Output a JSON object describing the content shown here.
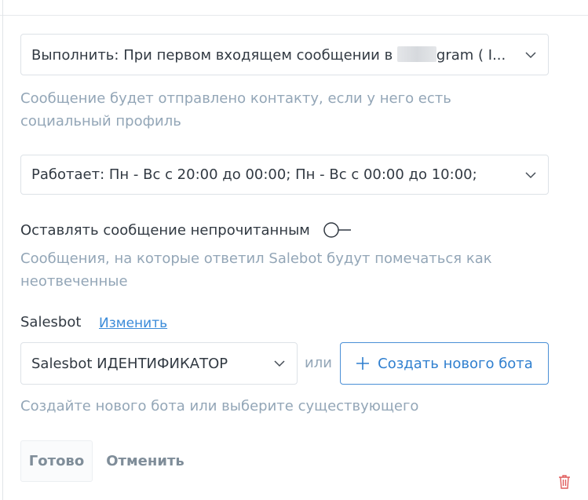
{
  "trigger_select": {
    "value_prefix": "Выполнить: При первом входящем сообщении в",
    "value_suffix": "gram ( I...",
    "icon": "chevron-down-icon"
  },
  "trigger_hint": {
    "line1": "Сообщение будет отправлено контакту, если у него есть",
    "line2": "социальный профиль"
  },
  "schedule_select": {
    "value": "Работает: Пн - Вс с 20:00 до 00:00; Пн - Вс с 00:00 до 10:00;",
    "icon": "chevron-down-icon"
  },
  "unread_toggle": {
    "label": "Оставлять сообщение непрочитанным",
    "on": false
  },
  "unread_hint": {
    "line1": "Сообщения, на которые ответил Salebot будут помечаться как",
    "line2": "неотвеченные"
  },
  "salesbot": {
    "label": "Salesbot",
    "change_link": "Изменить",
    "select_value": "Salesbot ИДЕНТИФИКАТОР",
    "or_text": "или",
    "create_button": "Создать нового бота",
    "hint": "Создайте нового бота или выберите существующего"
  },
  "actions": {
    "done": "Готово",
    "cancel": "Отменить"
  },
  "colors": {
    "text": "#313942",
    "hint": "#93a6b7",
    "link": "#3a8bd9",
    "delete": "#e05c5c"
  }
}
